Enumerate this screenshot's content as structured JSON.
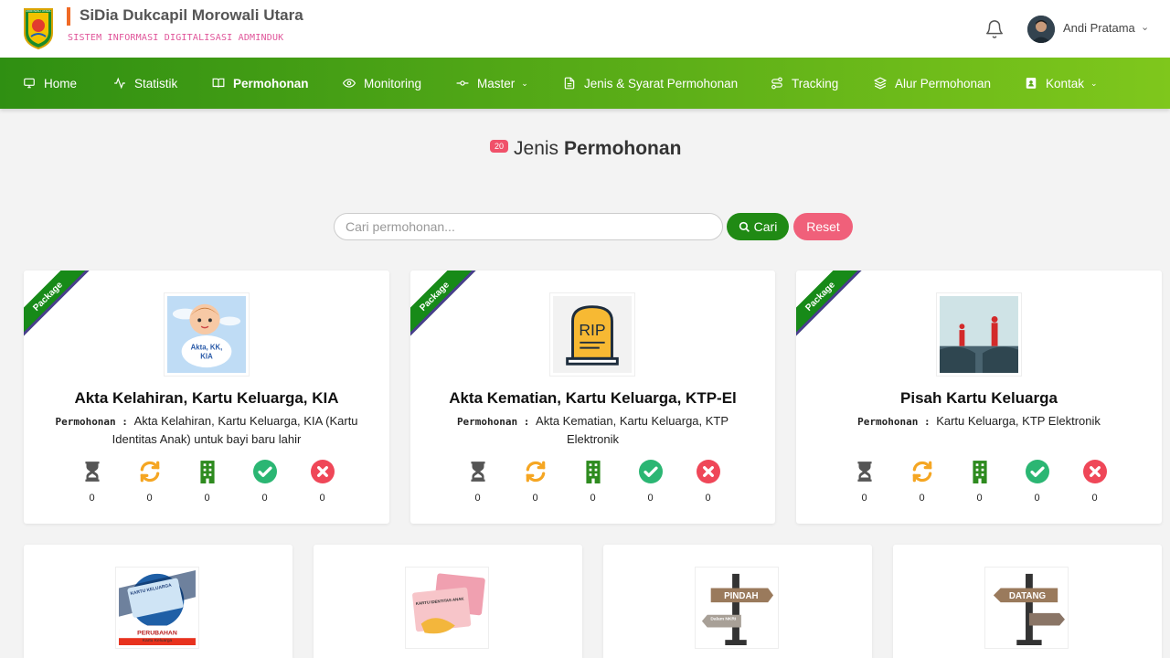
{
  "header": {
    "title": "SiDia Dukcapil Morowali Utara",
    "subtitle": "SISTEM INFORMASI DIGITALISASI ADMINDUK",
    "user_name": "Andi Pratama",
    "logo_text": "MOROWALI UTARA"
  },
  "nav": {
    "items": [
      {
        "label": "Home",
        "icon": "monitor-icon"
      },
      {
        "label": "Statistik",
        "icon": "activity-icon"
      },
      {
        "label": "Permohonan",
        "icon": "book-open-icon",
        "active": true
      },
      {
        "label": "Monitoring",
        "icon": "eye-icon"
      },
      {
        "label": "Master",
        "icon": "git-commit-icon",
        "dropdown": true
      },
      {
        "label": "Jenis & Syarat Permohonan",
        "icon": "file-text-icon"
      },
      {
        "label": "Tracking",
        "icon": "route-icon"
      },
      {
        "label": "Alur Permohonan",
        "icon": "layers-icon"
      },
      {
        "label": "Kontak",
        "icon": "contact-icon",
        "dropdown": true
      }
    ]
  },
  "page": {
    "count": "20",
    "title_regular": "Jenis",
    "title_bold": "Permohonan"
  },
  "search": {
    "placeholder": "Cari permohonan...",
    "value": "",
    "search_label": "Cari",
    "reset_label": "Reset"
  },
  "cards": [
    {
      "ribbon": "Package",
      "title": "Akta Kelahiran, Kartu Keluarga, KIA",
      "desc_label": "Permohonan",
      "desc": "Akta Kelahiran, Kartu Keluarga, KIA (Kartu Identitas Anak) untuk bayi baru lahir",
      "image_text": "Akta, KK, KIA",
      "stats": [
        "0",
        "0",
        "0",
        "0",
        "0"
      ]
    },
    {
      "ribbon": "Package",
      "title": "Akta Kematian, Kartu Keluarga, KTP-El",
      "desc_label": "Permohonan",
      "desc": "Akta Kematian, Kartu Keluarga, KTP Elektronik",
      "image_text": "RIP",
      "stats": [
        "0",
        "0",
        "0",
        "0",
        "0"
      ]
    },
    {
      "ribbon": "Package",
      "title": "Pisah Kartu Keluarga",
      "desc_label": "Permohonan",
      "desc": "Kartu Keluarga, KTP Elektronik",
      "image_text": "",
      "stats": [
        "0",
        "0",
        "0",
        "0",
        "0"
      ]
    }
  ],
  "cards_row2": [
    {
      "image_text": "KARTU KELUARGA",
      "image_caption": "PERUBAHAN",
      "image_caption_small": "Kartu Keluarga"
    },
    {
      "image_text": "KARTU IDENTITAS ANAK"
    },
    {
      "image_text": "PINDAH",
      "image_caption_small": "Dalam NKRI"
    },
    {
      "image_text": "DATANG"
    }
  ],
  "stat_icons": [
    "hourglass-icon",
    "sync-icon",
    "building-icon",
    "check-circle-icon",
    "times-circle-icon"
  ],
  "colors": {
    "nav_start": "#2f8f12",
    "nav_end": "#7fc71c",
    "brand_accent": "#f06a25",
    "subtitle": "#e0559a",
    "search_button": "#208a14",
    "reset_button": "#f0607a",
    "ribbon": "#178a18",
    "pending": "#555555",
    "process": "#f5a623",
    "office": "#2e8b1f",
    "done": "#2bb673",
    "rejected": "#ef4758"
  }
}
